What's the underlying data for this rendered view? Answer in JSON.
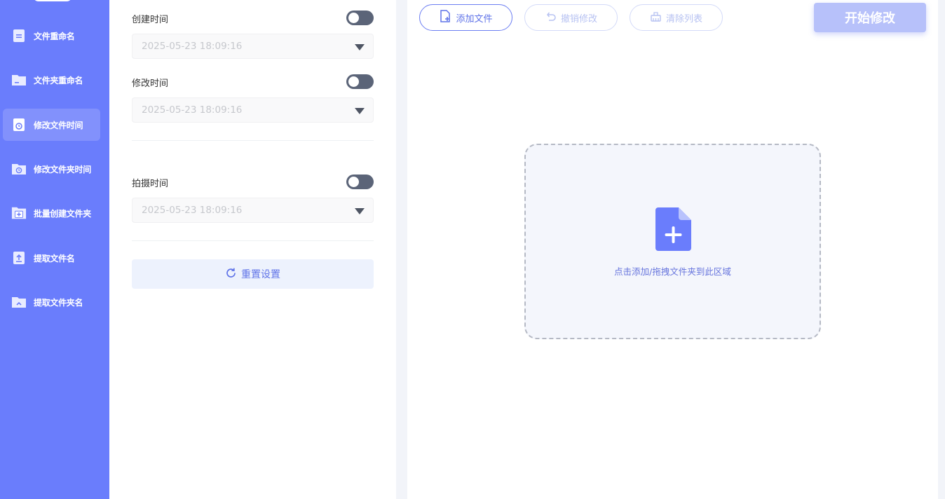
{
  "sidebar": {
    "items": [
      {
        "label": "文件重命名",
        "icon": "file-doc-icon"
      },
      {
        "label": "文件夹重命名",
        "icon": "folder-icon"
      },
      {
        "label": "修改文件时间",
        "icon": "file-clock-icon",
        "active": true
      },
      {
        "label": "修改文件夹时间",
        "icon": "folder-clock-icon"
      },
      {
        "label": "批量创建文件夹",
        "icon": "folder-plus-icon"
      },
      {
        "label": "提取文件名",
        "icon": "file-upload-icon"
      },
      {
        "label": "提取文件夹名",
        "icon": "folder-upload-icon"
      }
    ]
  },
  "settings": {
    "created": {
      "label": "创建时间",
      "value": "2025-05-23 18:09:16",
      "enabled": false
    },
    "modified": {
      "label": "修改时间",
      "value": "2025-05-23 18:09:16",
      "enabled": false
    },
    "shot": {
      "label": "拍摄时间",
      "value": "2025-05-23 18:09:16",
      "enabled": false
    },
    "reset_label": "重置设置"
  },
  "toolbar": {
    "add_file": "添加文件",
    "undo": "撤销修改",
    "clear": "清除列表",
    "start": "开始修改"
  },
  "dropzone": {
    "text": "点击添加/拖拽文件夹到此区域"
  },
  "colors": {
    "accent": "#6a7dfc",
    "toggle_off": "#5b6478",
    "start_disabled": "#b7c1fa"
  }
}
